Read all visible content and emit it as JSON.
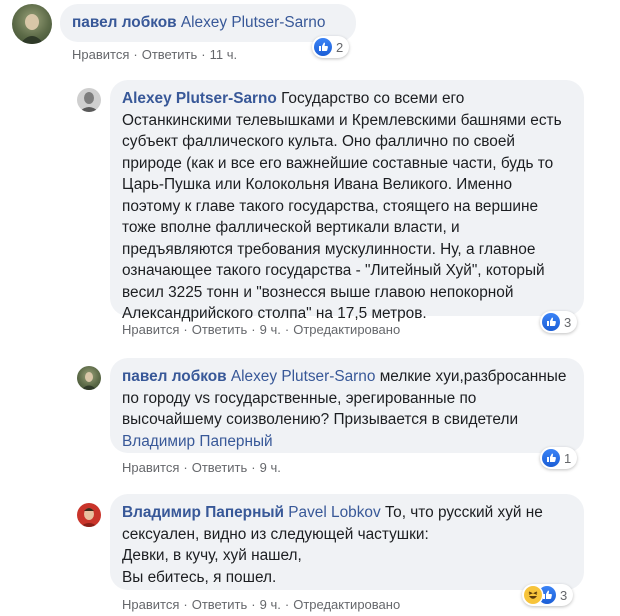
{
  "comments": [
    {
      "author": "павел лобков",
      "mention": "Alexey Plutser-Sarno",
      "actions": {
        "like": "Нравится",
        "reply": "Ответить",
        "time": "11 ч."
      },
      "reactions": "2"
    },
    {
      "author": "Alexey Plutser-Sarno",
      "text": "Государство со всеми его Останкинскими телевышками и Кремлевскими башнями есть субъект фаллического культа. Оно фаллично по своей природе (как и все его важнейшие составные части, будь то Царь-Пушка или Колокольня Ивана Великого. Именно поэтому к главе такого государства, стоящего на вершине тоже вполне фаллической вертикали власти, и предъявляются требования мускулинности. Ну, а главное означающее такого государства - \"Литейный Хуй\", который весил 3225 тонн и \"вознесся выше главою непокорной Александрийского столпа\" на 17,5 метров.",
      "actions": {
        "like": "Нравится",
        "reply": "Ответить",
        "time": "9 ч.",
        "edited": "Отредактировано"
      },
      "reactions": "3"
    },
    {
      "author": "павел лобков",
      "mention": "Alexey Plutser-Sarno",
      "text": "мелкие хуи,разбросанные по городу vs государственные, эрегированные по высочайшему соизволению? Призывается в свидетели",
      "mention2": "Владимир Паперный",
      "actions": {
        "like": "Нравится",
        "reply": "Ответить",
        "time": "9 ч."
      },
      "reactions": "1"
    },
    {
      "author": "Владимир Паперный",
      "mention": "Pavel Lobkov",
      "text": "То, что русский хуй не сексуален, видно из следующей частушки:",
      "verse1": "Девки, в кучу, хуй нашел,",
      "verse2": "Вы ебитесь, я пошел.",
      "actions": {
        "like": "Нравится",
        "reply": "Ответить",
        "time": "9 ч.",
        "edited": "Отредактировано"
      },
      "reactions": "3"
    }
  ],
  "colors": {
    "link": "#385898",
    "bubble": "#f0f2f5",
    "meta": "#65676b",
    "like_blue": "#1b74e4",
    "haha_yellow": "#f7c43b"
  }
}
